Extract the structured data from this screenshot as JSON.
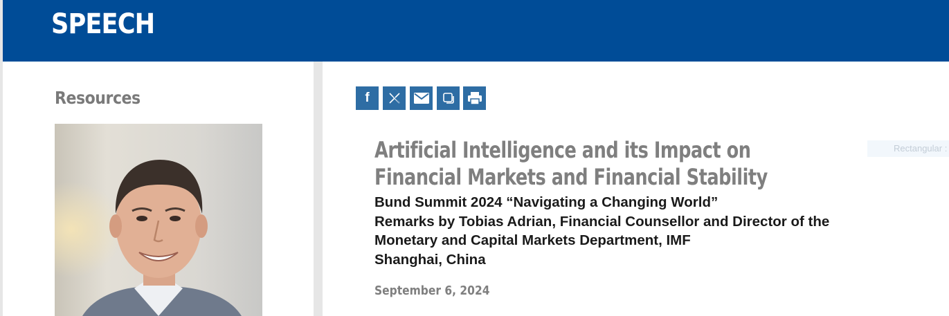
{
  "banner": {
    "title": "SPEECH",
    "color": "#004c97"
  },
  "sidebar": {
    "heading": "Resources",
    "photo_alt": "Tobias Adrian"
  },
  "share": {
    "buttons": [
      {
        "icon": "facebook-icon",
        "label": "f"
      },
      {
        "icon": "x-icon",
        "label": "𝕏"
      },
      {
        "icon": "email-icon",
        "label": ""
      },
      {
        "icon": "copy-link-icon",
        "label": ""
      },
      {
        "icon": "print-icon",
        "label": ""
      }
    ],
    "color": "#2e6da4"
  },
  "article": {
    "title": "Artificial Intelligence and its Impact on Financial Markets and Financial Stability",
    "subtitle_lines": [
      "Bund Summit 2024 “Navigating a Changing World”",
      "Remarks by Tobias Adrian, Financial Counsellor and Director of the",
      "Monetary and Capital Markets Department, IMF",
      "Shanghai, China"
    ],
    "date": "September 6, 2024"
  },
  "overlay": {
    "label": "Rectangular :"
  }
}
